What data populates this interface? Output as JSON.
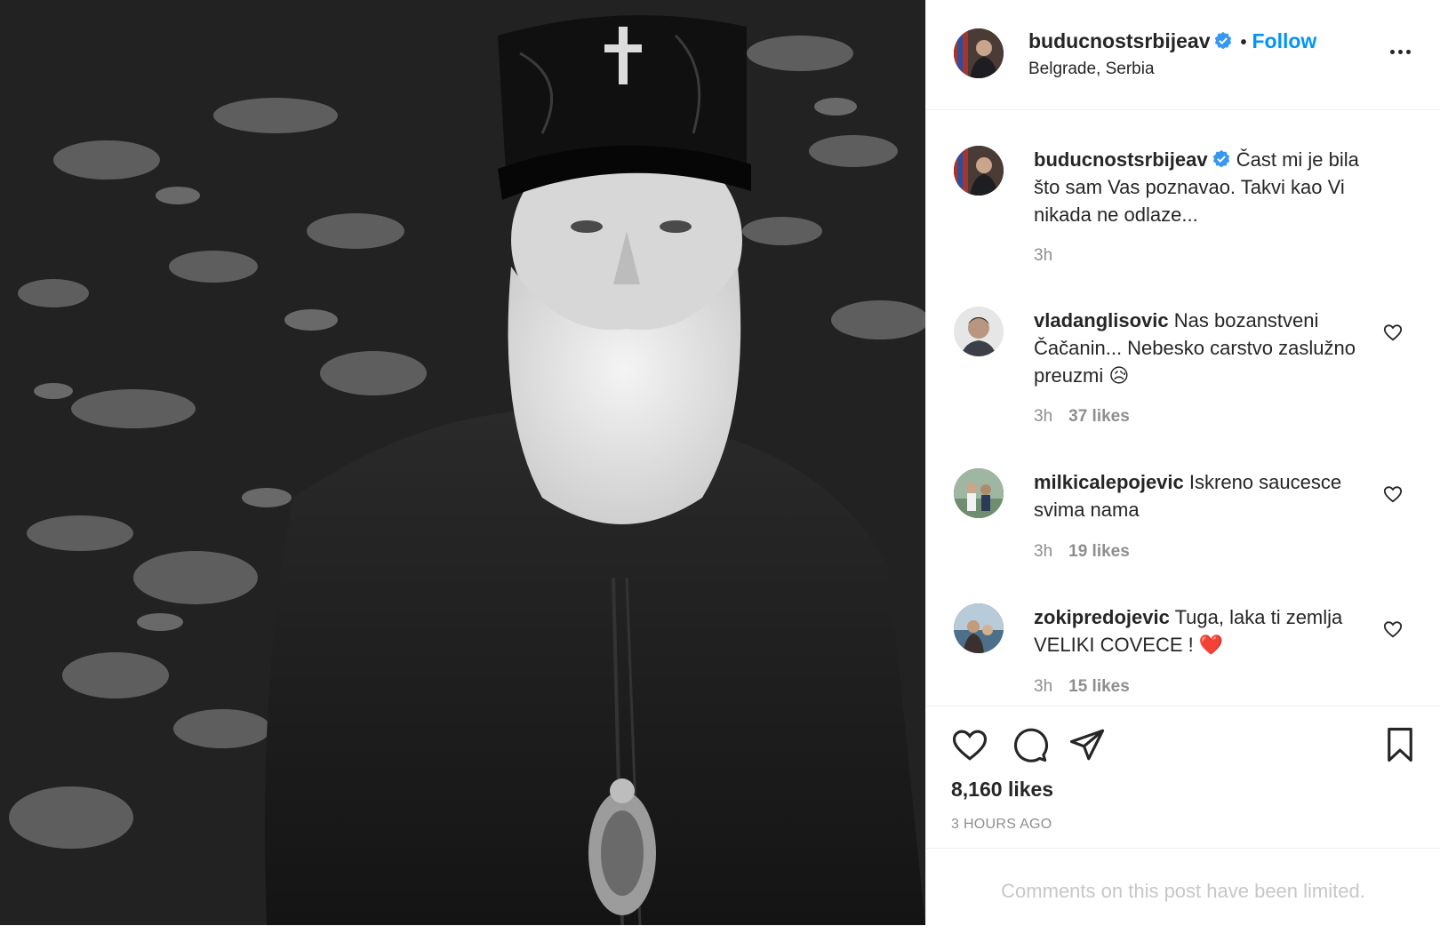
{
  "post": {
    "author": {
      "username": "buducnostsrbijeav",
      "verified": true,
      "follow_label": "Follow",
      "location": "Belgrade, Serbia"
    },
    "more_icon": "more-options-icon",
    "caption": {
      "username": "buducnostsrbijeav",
      "text": "Čast mi je bila što sam Vas poznavao. Takvi kao Vi nikada ne odlaze...",
      "time": "3h"
    },
    "comments": [
      {
        "username": "vladanglisovic",
        "text": "Nas bozanstveni Čačanin... Nebesko carstvo zaslužno preuzmi",
        "emoji": "😥",
        "time": "3h",
        "likes": "37 likes"
      },
      {
        "username": "milkicalepojevic",
        "text": "Iskreno saucesce svima nama",
        "emoji": "",
        "time": "3h",
        "likes": "19 likes"
      },
      {
        "username": "zokipredojevic",
        "text": "Tuga, laka ti zemlja VELIKI COVECE !",
        "emoji": "❤️",
        "time": "3h",
        "likes": "15 likes"
      }
    ],
    "actions": {
      "like_icon": "heart-icon",
      "comment_icon": "comment-icon",
      "share_icon": "share-icon",
      "save_icon": "bookmark-icon"
    },
    "likes_count": "8,160 likes",
    "time_ago": "3 HOURS AGO",
    "comments_limited": "Comments on this post have been limited."
  },
  "colors": {
    "link": "#0095f6",
    "muted": "#8e8e8e",
    "text": "#262626",
    "verified": "#3897f0"
  }
}
